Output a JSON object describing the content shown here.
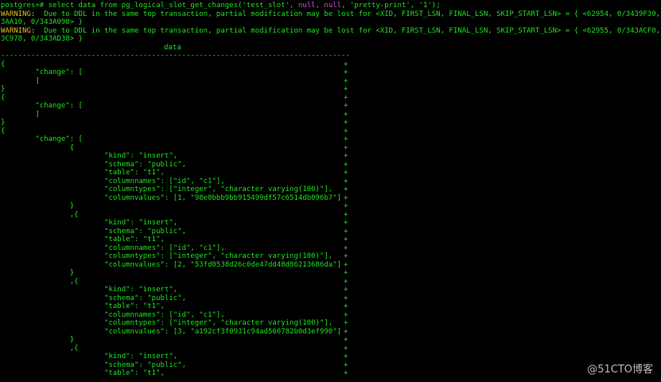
{
  "terminal": {
    "prompt": "postgres=# ",
    "command": {
      "part1": "select data from pg_logical_slot_get_changes('test_slot', ",
      "kw1": "null",
      "sep": ", ",
      "kw2": "null",
      "part2": ", 'pretty-print', '1');"
    },
    "warnings": [
      {
        "label": "WARNING:",
        "line1": "  Due to DDL in the same top transaction, partial modification may be lost for <XID, FIRST_LSN, FINAL_LSN, SKIP_START_LSN> = { <62954, 0/3439F30, 0/34",
        "line2": "3AA10, 0/343A098> }"
      },
      {
        "label": "WARNING:",
        "line1": "  Due to DDL in the same top transaction, partial modification may be lost for <XID, FIRST_LSN, FINAL_LSN, SKIP_START_LSN> = { <62955, 0/343ACF0, 0/34",
        "line2": "3C978, 0/343AD38> }"
      }
    ],
    "column_header": "data",
    "separator": "---------------------------------------------------------------------------------",
    "continuation": "+",
    "rows": [
      "{",
      "        \"change\": [",
      "        ]",
      "}",
      "{",
      "        \"change\": [",
      "        ]",
      "}",
      "{",
      "        \"change\": [",
      "                {",
      "                        \"kind\": \"insert\",",
      "                        \"schema\": \"public\",",
      "                        \"table\": \"t1\",",
      "                        \"columnnames\": [\"id\", \"c1\"],",
      "                        \"columntypes\": [\"integer\", \"character varying(100)\"],",
      "                        \"columnvalues\": [1, \"98e0bbb9bb915499df57c6514db096b7\"]",
      "                }",
      "                ,{",
      "                        \"kind\": \"insert\",",
      "                        \"schema\": \"public\",",
      "                        \"table\": \"t1\",",
      "                        \"columnnames\": [\"id\", \"c1\"],",
      "                        \"columntypes\": [\"integer\", \"character varying(100)\"],",
      "                        \"columnvalues\": [2, \"53fd0538d26c0de47dd48d86213686da\"]",
      "                }",
      "                ,{",
      "                        \"kind\": \"insert\",",
      "                        \"schema\": \"public\",",
      "                        \"table\": \"t1\",",
      "                        \"columnnames\": [\"id\", \"c1\"],",
      "                        \"columntypes\": [\"integer\", \"character varying(100)\"],",
      "                        \"columnvalues\": [3, \"a192cf3f0931c94ad560782b0d3ef990\"]",
      "                }",
      "                ,{",
      "                        \"kind\": \"insert\",",
      "                        \"schema\": \"public\",",
      "                        \"table\": \"t1\","
    ]
  },
  "watermark": "@51CTO博客",
  "colors": {
    "background": "#000000",
    "text": "#1ee01e",
    "keyword": "#c34fd0",
    "warning": "#e0c020"
  }
}
